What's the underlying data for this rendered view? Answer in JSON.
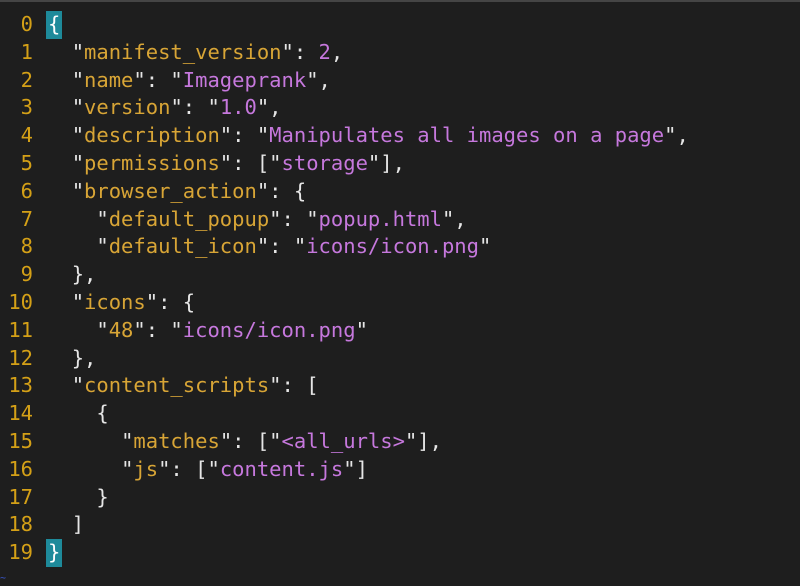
{
  "editor": {
    "colors": {
      "background": "#1e1e1e",
      "line_number": "#d4a017",
      "key": "#d8a536",
      "string": "#c678dd",
      "punctuation": "#e6e6e6",
      "bracket_highlight": "#1e8a9a"
    },
    "lines": [
      {
        "num": "0",
        "indent": "",
        "tokens": [
          {
            "t": "{",
            "c": "bracket"
          }
        ]
      },
      {
        "num": "1",
        "indent": "  ",
        "tokens": [
          {
            "t": "\"",
            "c": "p"
          },
          {
            "t": "manifest_version",
            "c": "key"
          },
          {
            "t": "\": ",
            "c": "p"
          },
          {
            "t": "2",
            "c": "num"
          },
          {
            "t": ",",
            "c": "p"
          }
        ]
      },
      {
        "num": "2",
        "indent": "  ",
        "tokens": [
          {
            "t": "\"",
            "c": "p"
          },
          {
            "t": "name",
            "c": "key"
          },
          {
            "t": "\": \"",
            "c": "p"
          },
          {
            "t": "Imageprank",
            "c": "str"
          },
          {
            "t": "\",",
            "c": "p"
          }
        ]
      },
      {
        "num": "3",
        "indent": "  ",
        "tokens": [
          {
            "t": "\"",
            "c": "p"
          },
          {
            "t": "version",
            "c": "key"
          },
          {
            "t": "\": \"",
            "c": "p"
          },
          {
            "t": "1.0",
            "c": "str"
          },
          {
            "t": "\",",
            "c": "p"
          }
        ]
      },
      {
        "num": "4",
        "indent": "  ",
        "tokens": [
          {
            "t": "\"",
            "c": "p"
          },
          {
            "t": "description",
            "c": "key"
          },
          {
            "t": "\": \"",
            "c": "p"
          },
          {
            "t": "Manipulates all images on a page",
            "c": "str"
          },
          {
            "t": "\",",
            "c": "p"
          }
        ]
      },
      {
        "num": "5",
        "indent": "  ",
        "tokens": [
          {
            "t": "\"",
            "c": "p"
          },
          {
            "t": "permissions",
            "c": "key"
          },
          {
            "t": "\": [\"",
            "c": "p"
          },
          {
            "t": "storage",
            "c": "str"
          },
          {
            "t": "\"],",
            "c": "p"
          }
        ]
      },
      {
        "num": "6",
        "indent": "  ",
        "tokens": [
          {
            "t": "\"",
            "c": "p"
          },
          {
            "t": "browser_action",
            "c": "key"
          },
          {
            "t": "\": {",
            "c": "p"
          }
        ]
      },
      {
        "num": "7",
        "indent": "    ",
        "tokens": [
          {
            "t": "\"",
            "c": "p"
          },
          {
            "t": "default_popup",
            "c": "key"
          },
          {
            "t": "\": \"",
            "c": "p"
          },
          {
            "t": "popup.html",
            "c": "str"
          },
          {
            "t": "\",",
            "c": "p"
          }
        ]
      },
      {
        "num": "8",
        "indent": "    ",
        "tokens": [
          {
            "t": "\"",
            "c": "p"
          },
          {
            "t": "default_icon",
            "c": "key"
          },
          {
            "t": "\": \"",
            "c": "p"
          },
          {
            "t": "icons/icon.png",
            "c": "str"
          },
          {
            "t": "\"",
            "c": "p"
          }
        ]
      },
      {
        "num": "9",
        "indent": "  ",
        "tokens": [
          {
            "t": "},",
            "c": "p"
          }
        ]
      },
      {
        "num": "10",
        "indent": "  ",
        "tokens": [
          {
            "t": "\"",
            "c": "p"
          },
          {
            "t": "icons",
            "c": "key"
          },
          {
            "t": "\": {",
            "c": "p"
          }
        ]
      },
      {
        "num": "11",
        "indent": "    ",
        "tokens": [
          {
            "t": "\"",
            "c": "p"
          },
          {
            "t": "48",
            "c": "key"
          },
          {
            "t": "\": \"",
            "c": "p"
          },
          {
            "t": "icons/icon.png",
            "c": "str"
          },
          {
            "t": "\"",
            "c": "p"
          }
        ]
      },
      {
        "num": "12",
        "indent": "  ",
        "tokens": [
          {
            "t": "},",
            "c": "p"
          }
        ]
      },
      {
        "num": "13",
        "indent": "  ",
        "tokens": [
          {
            "t": "\"",
            "c": "p"
          },
          {
            "t": "content_scripts",
            "c": "key"
          },
          {
            "t": "\": [",
            "c": "p"
          }
        ]
      },
      {
        "num": "14",
        "indent": "    ",
        "tokens": [
          {
            "t": "{",
            "c": "p"
          }
        ]
      },
      {
        "num": "15",
        "indent": "      ",
        "tokens": [
          {
            "t": "\"",
            "c": "p"
          },
          {
            "t": "matches",
            "c": "key"
          },
          {
            "t": "\": [\"",
            "c": "p"
          },
          {
            "t": "<all_urls>",
            "c": "str"
          },
          {
            "t": "\"],",
            "c": "p"
          }
        ]
      },
      {
        "num": "16",
        "indent": "      ",
        "tokens": [
          {
            "t": "\"",
            "c": "p"
          },
          {
            "t": "js",
            "c": "key"
          },
          {
            "t": "\": [\"",
            "c": "p"
          },
          {
            "t": "content.js",
            "c": "str"
          },
          {
            "t": "\"]",
            "c": "p"
          }
        ]
      },
      {
        "num": "17",
        "indent": "    ",
        "tokens": [
          {
            "t": "}",
            "c": "p"
          }
        ]
      },
      {
        "num": "18",
        "indent": "  ",
        "tokens": [
          {
            "t": "]",
            "c": "p"
          }
        ]
      },
      {
        "num": "19",
        "indent": "",
        "tokens": [
          {
            "t": "}",
            "c": "bracket"
          }
        ]
      }
    ],
    "end_marker": "~"
  }
}
